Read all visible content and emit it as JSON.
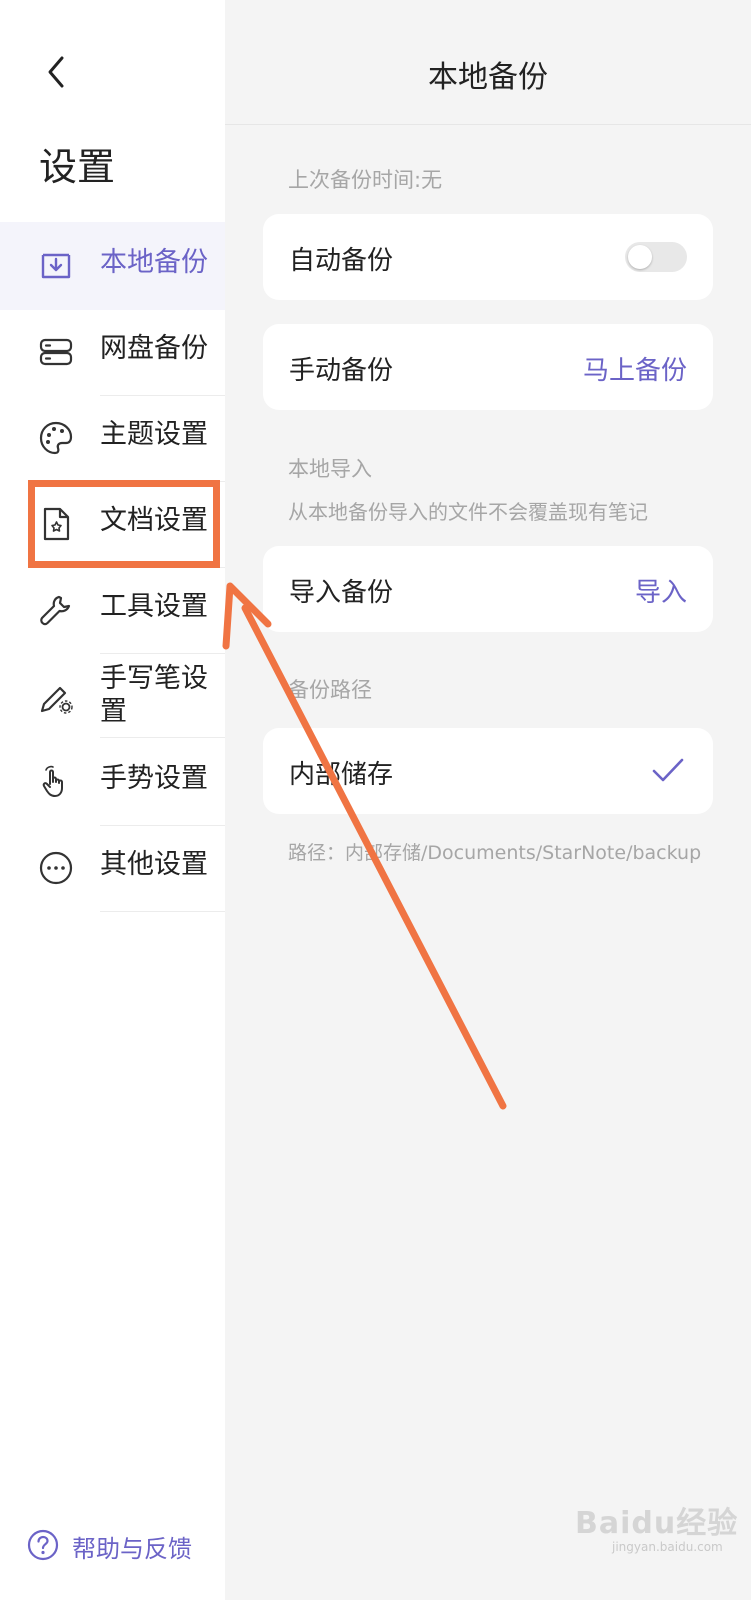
{
  "sidebar": {
    "title": "设置",
    "items": [
      {
        "label": "本地备份",
        "icon": "local-backup-icon",
        "active": true
      },
      {
        "label": "网盘备份",
        "icon": "cloud-disk-icon",
        "active": false
      },
      {
        "label": "主题设置",
        "icon": "palette-icon",
        "active": false
      },
      {
        "label": "文档设置",
        "icon": "document-settings-icon",
        "active": false
      },
      {
        "label": "工具设置",
        "icon": "wrench-icon",
        "active": false
      },
      {
        "label": "手写笔设置",
        "icon": "pen-settings-icon",
        "active": false
      },
      {
        "label": "手势设置",
        "icon": "gesture-hand-icon",
        "active": false
      },
      {
        "label": "其他设置",
        "icon": "more-icon",
        "active": false
      }
    ],
    "help_label": "帮助与反馈"
  },
  "main": {
    "title": "本地备份",
    "last_backup": "上次备份时间:无",
    "auto_backup": {
      "label": "自动备份",
      "enabled": false
    },
    "manual_backup": {
      "label": "手动备份",
      "action": "马上备份"
    },
    "local_import": {
      "section_label": "本地导入",
      "description": "从本地备份导入的文件不会覆盖现有笔记",
      "label": "导入备份",
      "action": "导入"
    },
    "backup_path": {
      "section_label": "备份路径",
      "option_label": "内部储存",
      "selected": true,
      "path_text": "路径：内部存储/Documents/StarNote/backup"
    }
  },
  "watermark": {
    "text": "Baidu经验",
    "sub": "jingyan.baidu.com"
  },
  "colors": {
    "accent": "#6b63c7",
    "annotation": "#f07443",
    "panel_bg": "#f4f4f4"
  }
}
